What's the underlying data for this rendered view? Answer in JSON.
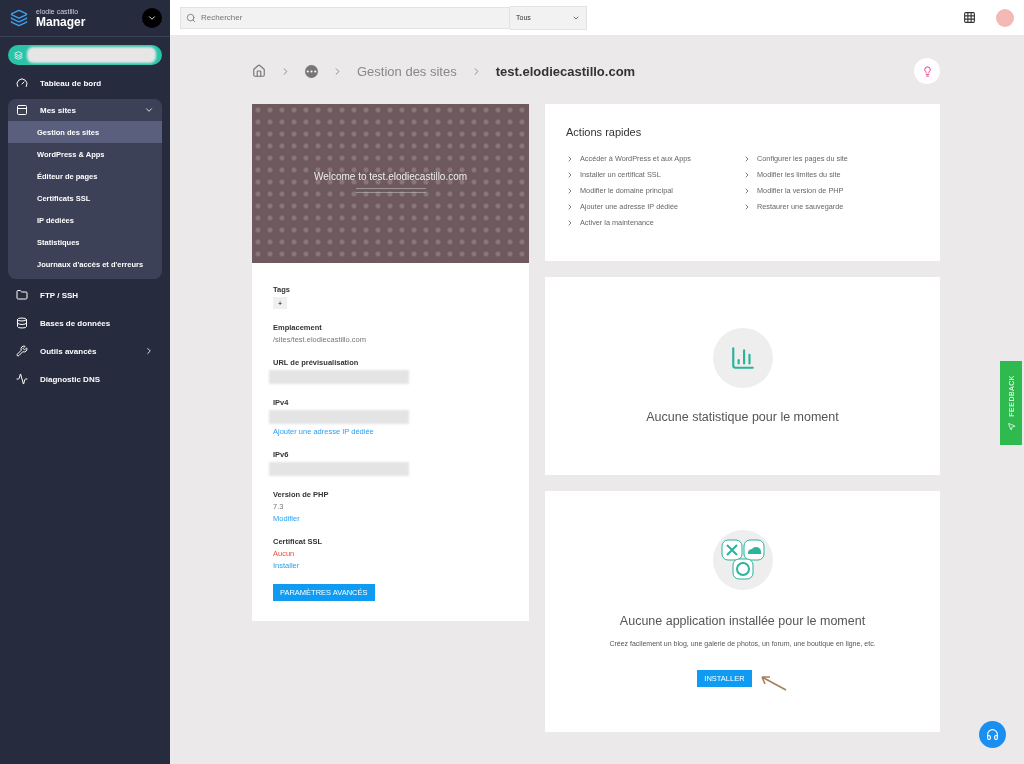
{
  "brand": {
    "account": "elodie castillo",
    "title": "Manager"
  },
  "sidebar": {
    "items": [
      {
        "label": "Tableau de bord"
      },
      {
        "label": "Mes sites",
        "expanded": true,
        "children": [
          {
            "label": "Gestion des sites",
            "selected": true
          },
          {
            "label": "WordPress & Apps",
            "selected": false
          },
          {
            "label": "Éditeur de pages",
            "selected": false
          },
          {
            "label": "Certificats SSL",
            "selected": false
          },
          {
            "label": "IP dédiées",
            "selected": false
          },
          {
            "label": "Statistiques",
            "selected": false
          },
          {
            "label": "Journaux d'accès et d'erreurs",
            "selected": false
          }
        ]
      },
      {
        "label": "FTP / SSH"
      },
      {
        "label": "Bases de données"
      },
      {
        "label": "Outils avancés",
        "expanded": false
      },
      {
        "label": "Diagnostic DNS"
      }
    ]
  },
  "search": {
    "placeholder": "Rechercher",
    "filter": "Tous"
  },
  "breadcrumb": [
    {
      "label": "Gestion des sites",
      "current": false
    },
    {
      "label": "test.elodiecastillo.com",
      "current": true
    }
  ],
  "preview": {
    "title": "Welcome to test.elodiecastillo.com"
  },
  "details": {
    "tags_label": "Tags",
    "tags_add": "+",
    "fields": [
      {
        "kind": "text",
        "label": "Emplacement",
        "value": "/sites/test.elodiecastillo.com"
      },
      {
        "kind": "redacted",
        "label": "URL de prévisualisation"
      },
      {
        "kind": "redacted",
        "label": "IPv4",
        "link": "Ajouter une adresse IP dédiée"
      },
      {
        "kind": "redacted",
        "label": "IPv6"
      },
      {
        "kind": "text",
        "label": "Version de PHP",
        "value": "7.3",
        "error": false,
        "link": "Modifier"
      },
      {
        "kind": "text",
        "label": "Certificat SSL",
        "value": "Aucun",
        "error": true,
        "link": "Installer"
      }
    ],
    "button": "PARAMÈTRES AVANCÉS"
  },
  "quick_actions": {
    "title": "Actions rapides",
    "columns": [
      [
        "Accéder à WordPress et aux Apps",
        "Installer un certificat SSL",
        "Modifier le domaine principal",
        "Ajouter une adresse IP dédiée",
        "Activer la maintenance"
      ],
      [
        "Configurer les pages du site",
        "Modifier les limites du site",
        "Modifier la version de PHP",
        "Restaurer une sauvegarde"
      ]
    ]
  },
  "stats": {
    "message": "Aucune statistique pour le moment"
  },
  "apps": {
    "title": "Aucune application installée pour le moment",
    "description": "Créez facilement un blog, une galerie de photos, un forum, une boutique en ligne, etc.",
    "button": "INSTALLER"
  },
  "feedback": "FEEDBACK"
}
